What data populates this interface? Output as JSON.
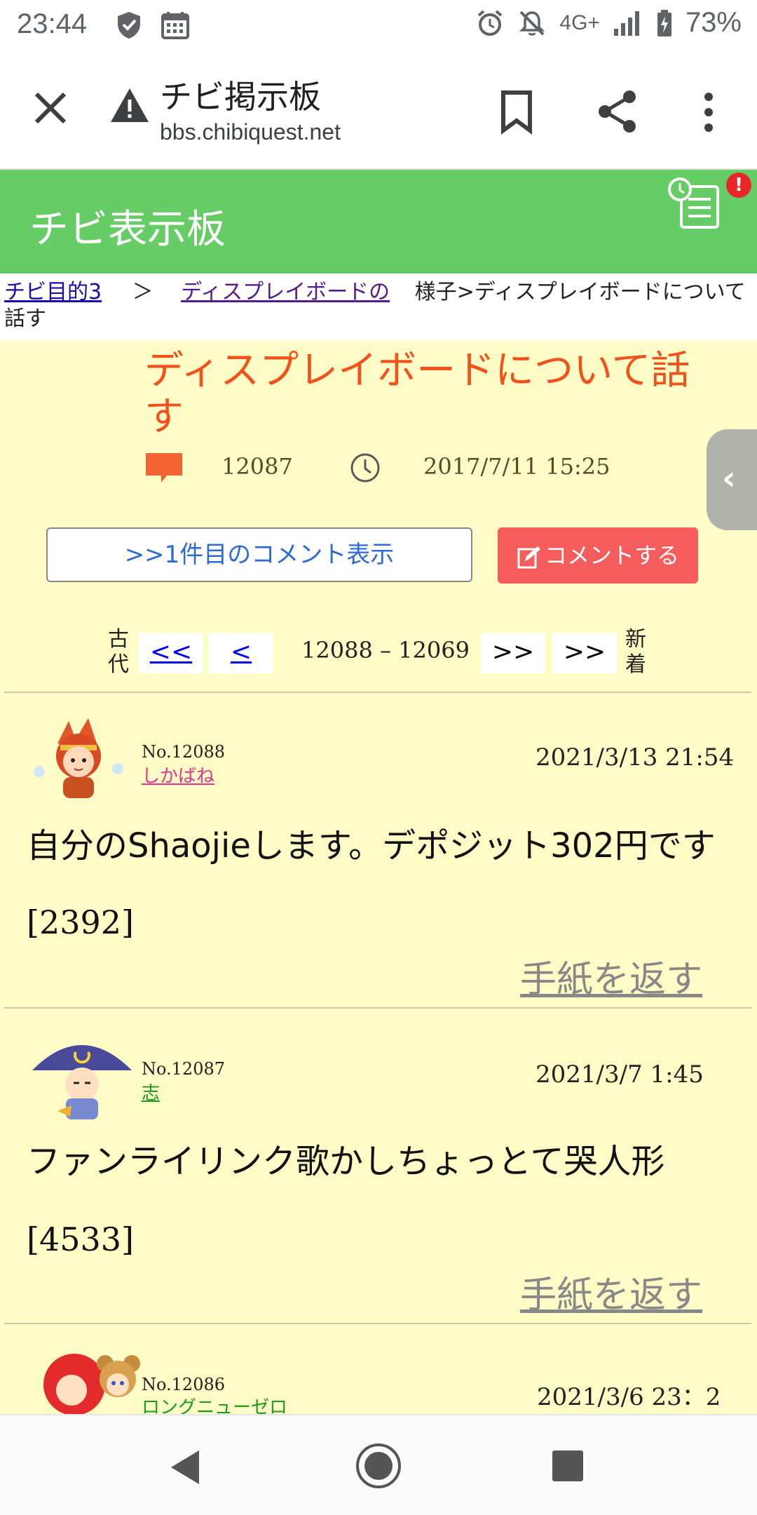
{
  "status_bar": {
    "time": "23:44",
    "network": "4G+",
    "battery": "73%"
  },
  "browser": {
    "page_title": "チビ掲示板",
    "url": "bbs.chibiquest.net"
  },
  "site": {
    "header_title": "チビ表示板",
    "alert_badge": "!"
  },
  "breadcrumb": {
    "link1": "チビ目的3",
    "sep": "＞",
    "link2": "ディスプレイボードの",
    "rest": "様子>ディスプレイボードについて話す"
  },
  "topic": {
    "title": "ディスプレイボードについて話す",
    "comment_count": "12087",
    "created": "2017/7/11 15:25"
  },
  "actions": {
    "first_comment_label": ">>1件目のコメント表示",
    "comment_label": "コメントする"
  },
  "pager": {
    "old_label": "古代",
    "new_label": "新着",
    "first": "<<",
    "prev": "<",
    "range": "12088 – 12069",
    "next": ">>",
    "last": ">>"
  },
  "posts": [
    {
      "no": "No.12088",
      "author": "しかばね",
      "author_color": "#e8338a",
      "date": "2021/3/13 21:54",
      "body": "自分のShaojieします。デポジット302円です",
      "id": "[2392]",
      "reply_label": "手紙を返す"
    },
    {
      "no": "No.12087",
      "author": "志",
      "author_color": "#1a9b1a",
      "date": "2021/3/7 1:45",
      "body": "ファンライリンク歌かしちょっとて哭人形",
      "id": "[4533]",
      "reply_label": "手紙を返す"
    },
    {
      "no": "No.12086",
      "author": "ロングニューゼロ",
      "author_color": "#1a9b1a",
      "date": "2021/3/6 23：2"
    }
  ],
  "colors": {
    "header_green": "#66cc66",
    "page_bg": "#fdfcc6",
    "title_orange": "#f2511b",
    "comment_button": "#f55c5c"
  }
}
